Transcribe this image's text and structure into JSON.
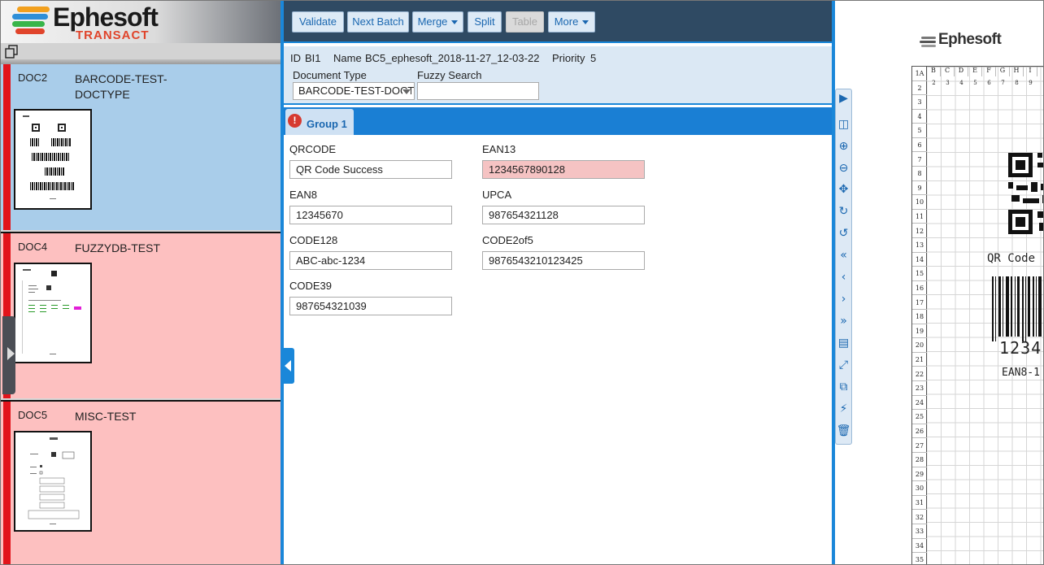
{
  "brand": {
    "name": "Ephesoft",
    "product": "TRANSACT"
  },
  "documents": [
    {
      "id": "DOC2",
      "type": "BARCODE-TEST-DOCTYPE"
    },
    {
      "id": "DOC4",
      "type": "FUZZYDB-TEST"
    },
    {
      "id": "DOC5",
      "type": "MISC-TEST"
    }
  ],
  "toolbar": {
    "validate": "Validate",
    "next_batch": "Next Batch",
    "merge": "Merge",
    "split": "Split",
    "table": "Table",
    "more": "More"
  },
  "batch": {
    "id_label": "ID",
    "id": "BI1",
    "name_label": "Name",
    "name": "BC5_ephesoft_2018-11-27_12-03-22",
    "priority_label": "Priority",
    "priority": "5"
  },
  "doc_type_field": {
    "label": "Document Type",
    "value": "BARCODE-TEST-DOCTYPE"
  },
  "fuzzy_search": {
    "label": "Fuzzy Search",
    "value": ""
  },
  "group": {
    "label": "Group 1",
    "error_icon": "!"
  },
  "fields": {
    "qrcode": {
      "label": "QRCODE",
      "value": "QR Code Success"
    },
    "ean13": {
      "label": "EAN13",
      "value": "1234567890128"
    },
    "ean8": {
      "label": "EAN8",
      "value": "12345670"
    },
    "upca": {
      "label": "UPCA",
      "value": "987654321128"
    },
    "code128": {
      "label": "CODE128",
      "value": "ABC-abc-1234"
    },
    "code2of5": {
      "label": "CODE2of5",
      "value": "9876543210123425"
    },
    "code39": {
      "label": "CODE39",
      "value": "987654321039"
    }
  },
  "viewer": {
    "logo": "Ephesoft",
    "col_headers": [
      "1A",
      "B",
      "C",
      "D",
      "E",
      "F",
      "G",
      "H",
      "I"
    ],
    "col_numbers": [
      "2",
      "3",
      "4",
      "5",
      "6",
      "7",
      "8",
      "9"
    ],
    "row_numbers": [
      "2",
      "3",
      "4",
      "5",
      "6",
      "7",
      "8",
      "9",
      "10",
      "11",
      "12",
      "13",
      "14",
      "15",
      "16",
      "17",
      "18",
      "19",
      "20",
      "21",
      "22",
      "23",
      "24",
      "25",
      "26",
      "27",
      "28",
      "29",
      "30",
      "31",
      "32",
      "33",
      "34",
      "35"
    ],
    "qr_caption": "QR Code",
    "barcode_digits": "1234",
    "ean8_caption": "EAN8-1"
  },
  "colors": {
    "accent": "#1a87d9",
    "toolbar_bg": "#2f4a63",
    "selected_doc": "#a9cdea",
    "error_doc": "#fdc0c0",
    "error_field": "#f5c3c3",
    "status_stripe": "#e2141b"
  }
}
